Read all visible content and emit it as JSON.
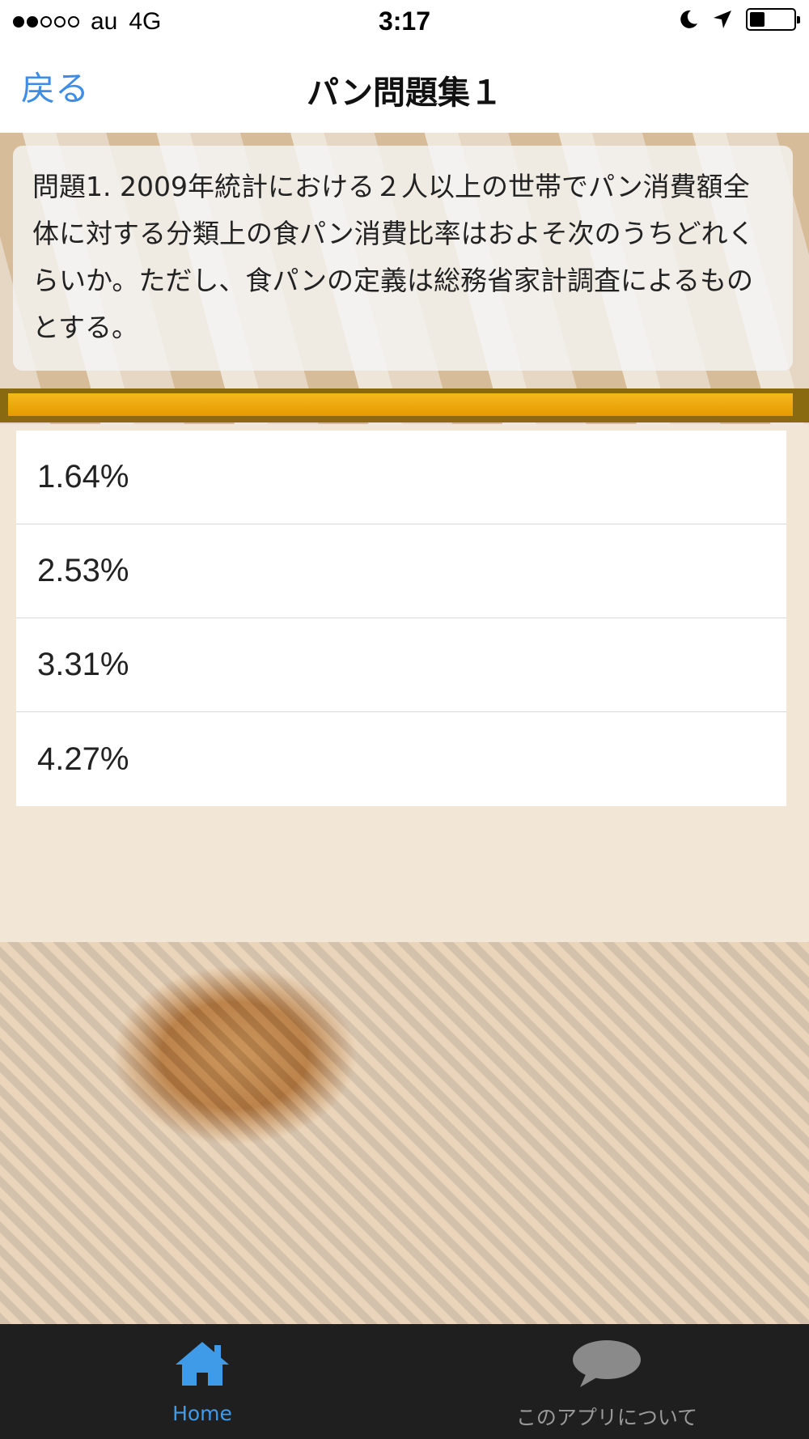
{
  "status_bar": {
    "carrier": "au",
    "network": "4G",
    "time": "3:17",
    "signal_strength": 2,
    "signal_max": 5,
    "battery_level": 0.35
  },
  "nav": {
    "back_label": "戻る",
    "title": "パン問題集１"
  },
  "question": {
    "text": "問題1. 2009年統計における２人以上の世帯でパン消費額全体に対する分類上の食パン消費比率はおよそ次のうちどれくらいか。ただし、食パンの定義は総務省家計調査によるものとする。"
  },
  "progress": {
    "fraction": 0.99
  },
  "answers": [
    {
      "label": "1.64%"
    },
    {
      "label": "2.53%"
    },
    {
      "label": "3.31%"
    },
    {
      "label": "4.27%"
    }
  ],
  "tabs": [
    {
      "label": "Home",
      "icon": "home-icon",
      "active": true
    },
    {
      "label": "このアプリについて",
      "icon": "speech-bubble-icon",
      "active": false
    }
  ],
  "colors": {
    "accent": "#3c8de8",
    "progress": "#f0a80c",
    "tab_bar": "#1f1f1f"
  }
}
